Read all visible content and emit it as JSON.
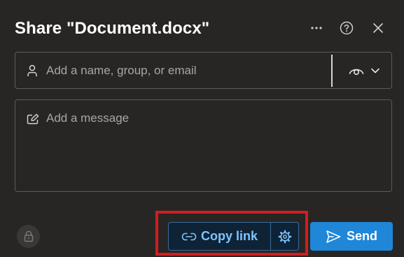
{
  "dialog": {
    "title": "Share \"Document.docx\"",
    "more_icon": "more-horizontal-icon",
    "help_icon": "question-circle-icon",
    "close_icon": "close-icon"
  },
  "recipients": {
    "placeholder": "Add a name, group, or email",
    "icon": "person-icon",
    "permission_icon": "eye-icon",
    "dropdown_icon": "chevron-down-icon"
  },
  "message": {
    "placeholder": "Add a message",
    "icon": "compose-pencil-icon"
  },
  "footer": {
    "lock_icon": "lock-icon",
    "copy_link_label": "Copy link",
    "copy_link_icon": "link-icon",
    "link_settings_icon": "gear-icon",
    "send_label": "Send",
    "send_icon": "send-arrow-icon"
  },
  "colors": {
    "background": "#282624",
    "accent": "#1f86d8",
    "copy_link_text": "#7ec4ff",
    "highlight": "#d01e20"
  }
}
